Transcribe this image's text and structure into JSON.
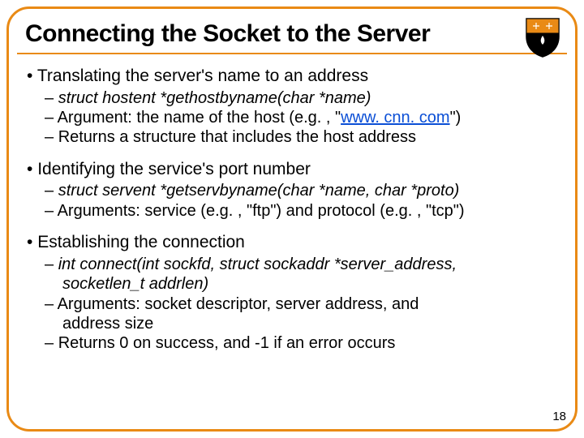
{
  "title": "Connecting the Socket to the Server",
  "sections": [
    {
      "bullet": "Translating the server's name to an address",
      "subs": [
        {
          "text": "struct hostent *gethostbyname(char *name)",
          "italic": true
        },
        {
          "text": "Argument: the name of the host (e.g. , \"",
          "link": "www. cnn. com",
          "after": "\")"
        },
        {
          "text": "Returns a structure that includes the host address"
        }
      ]
    },
    {
      "bullet": "Identifying the service's port number",
      "subs": [
        {
          "text": "struct servent *getservbyname(char *name, char *proto)",
          "italic": true
        },
        {
          "text": "Arguments: service (e.g. , \"ftp\") and protocol (e.g. , \"tcp\")"
        }
      ]
    },
    {
      "bullet": "Establishing the connection",
      "subs": [
        {
          "text": "int connect(int sockfd, struct sockaddr *server_address, socketlen_t addrlen)",
          "italic": true,
          "wrap": true
        },
        {
          "text": "Arguments: socket descriptor, server address, and address size",
          "wrap": true
        },
        {
          "text": "Returns 0 on success, and -1 if an error occurs"
        }
      ]
    }
  ],
  "page_number": "18"
}
